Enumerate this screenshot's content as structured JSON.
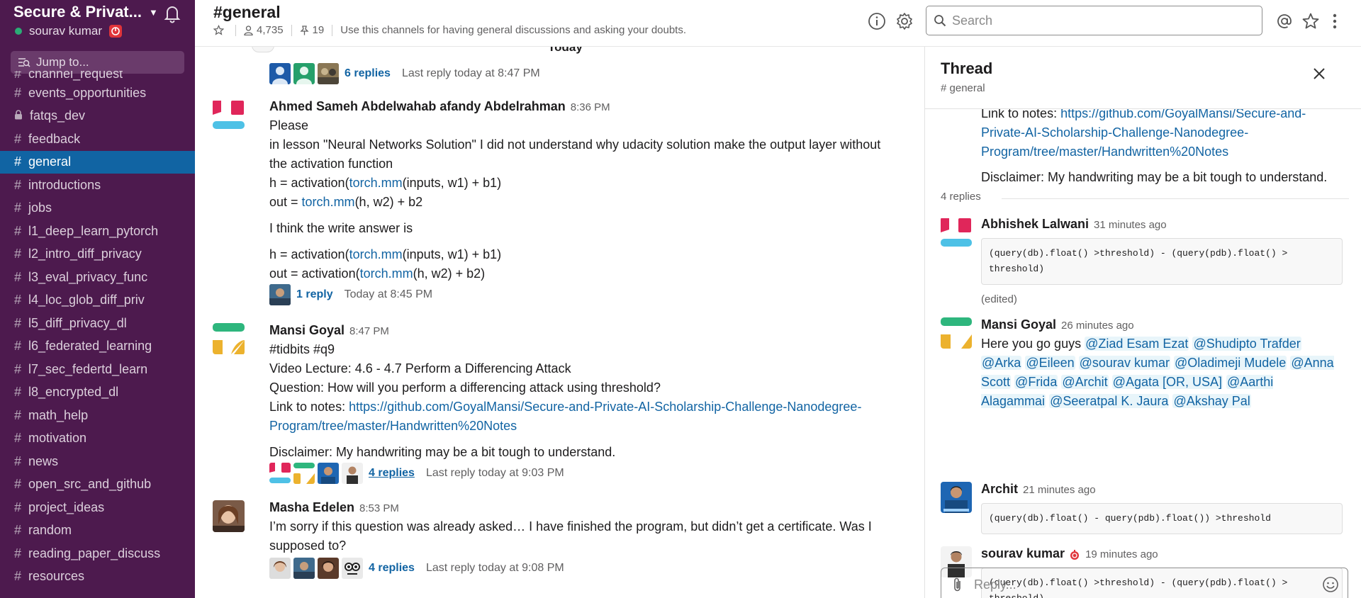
{
  "workspace": {
    "name": "Secure & Privat...",
    "user": "sourav kumar"
  },
  "sidebar": {
    "jump_placeholder": "Jump to...",
    "channels": [
      {
        "name": "channel_request",
        "private": false
      },
      {
        "name": "events_opportunities",
        "private": false
      },
      {
        "name": "fatqs_dev",
        "private": true
      },
      {
        "name": "feedback",
        "private": false
      },
      {
        "name": "general",
        "private": false
      },
      {
        "name": "introductions",
        "private": false
      },
      {
        "name": "jobs",
        "private": false
      },
      {
        "name": "l1_deep_learn_pytorch",
        "private": false
      },
      {
        "name": "l2_intro_diff_privacy",
        "private": false
      },
      {
        "name": "l3_eval_privacy_func",
        "private": false
      },
      {
        "name": "l4_loc_glob_diff_priv",
        "private": false
      },
      {
        "name": "l5_diff_privacy_dl",
        "private": false
      },
      {
        "name": "l6_federated_learning",
        "private": false
      },
      {
        "name": "l7_sec_federtd_learn",
        "private": false
      },
      {
        "name": "l8_encrypted_dl",
        "private": false
      },
      {
        "name": "math_help",
        "private": false
      },
      {
        "name": "motivation",
        "private": false
      },
      {
        "name": "news",
        "private": false
      },
      {
        "name": "open_src_and_github",
        "private": false
      },
      {
        "name": "project_ideas",
        "private": false
      },
      {
        "name": "random",
        "private": false
      },
      {
        "name": "reading_paper_discuss",
        "private": false
      },
      {
        "name": "resources",
        "private": false
      }
    ]
  },
  "header": {
    "channel": "#general",
    "members": "4,735",
    "pins": "19",
    "topic": "Use this channels for having general discussions and asking your doubts.",
    "search_placeholder": "Search"
  },
  "messages": {
    "day_divider": "Today",
    "top_thread": {
      "replies": "6 replies",
      "last": "Last reply today at 8:47 PM"
    },
    "m1": {
      "sender": "Ahmed Sameh Abdelwahab afandy Abdelrahman",
      "time": "8:36 PM",
      "l1": "Please",
      "l2": "in lesson \"Neural Networks Solution\" I did not understand why udacity solution make the output layer without",
      "l3": "the activation function",
      "c1a": "h = activation(",
      "c1b": "torch.mm",
      "c1c": "(inputs, w1) + b1)",
      "c2a": "out = ",
      "c2b": "torch.mm",
      "c2c": "(h, w2) + b2",
      "l4": "I think the write answer is",
      "c3a": "h = activation(",
      "c3b": "torch.mm",
      "c3c": "(inputs, w1) + b1)",
      "c4a": "out = activation(",
      "c4b": "torch.mm",
      "c4c": "(h, w2) + b2)",
      "replies": "1 reply",
      "last": "Today at 8:45 PM"
    },
    "m2": {
      "sender": "Mansi Goyal",
      "time": "8:47 PM",
      "l1": "#tidbits #q9",
      "l2": "Video Lecture: 4.6 - 4.7 Perform a Differencing Attack",
      "l3": "Question: How will you perform a differencing attack using threshold?",
      "l4": "Link to notes: ",
      "link1": "https://github.com/GoyalMansi/Secure-and-Private-AI-Scholarship-Challenge-Nanodegree-",
      "link2": "Program/tree/master/Handwritten%20Notes",
      "l5": "Disclaimer: My handwriting may be a bit tough to understand.",
      "replies": "4 replies",
      "last": "Last reply today at 9:03 PM"
    },
    "m3": {
      "sender": "Masha Edelen",
      "time": "8:53 PM",
      "l1": "I’m sorry if this question was already asked… I have finished the program, but didn’t get a certificate. Was I",
      "l2": "supposed to?",
      "replies": "4 replies",
      "last": "Last reply today at 9:08 PM"
    }
  },
  "thread": {
    "title": "Thread",
    "channel": "# general",
    "parent": {
      "l1a": "Link to notes: ",
      "l1b": "https://github.com/GoyalMansi/Secure-and-",
      "l2": "Private-AI-Scholarship-Challenge-Nanodegree-",
      "l3": "Program/tree/master/Handwritten%20Notes",
      "l4": "Disclaimer: My handwriting may be a bit tough to understand."
    },
    "reply_count": "4 replies",
    "r1": {
      "sender": "Abhishek Lalwani",
      "time": "31 minutes ago",
      "code1": "(query(db).float() >threshold) - (query(pdb).float() >",
      "code2": "threshold)",
      "edited": "(edited)"
    },
    "r2": {
      "sender": "Mansi Goyal",
      "time": "26 minutes ago",
      "text": "Here you go guys ",
      "mentions": [
        "@Ziad Esam Ezat",
        "@Shudipto Trafder",
        "@Arka",
        "@Eileen",
        "@sourav kumar",
        "@Oladimeji Mudele",
        "@Anna Scott",
        "@Frida",
        "@Archit",
        "@Agata [OR, USA]",
        "@Aarthi Alagammai",
        "@Seeratpal K. Jaura",
        "@Akshay Pal"
      ]
    },
    "r3": {
      "sender": "Archit",
      "time": "21 minutes ago",
      "code1": "(query(db).float() - query(pdb).float()) >threshold"
    },
    "r4": {
      "sender": "sourav kumar",
      "time": "19 minutes ago",
      "code1": "(query(db).float() >threshold) - (query(pdb).float() >",
      "code2": "threshold)"
    },
    "reply_placeholder": "Reply..."
  }
}
